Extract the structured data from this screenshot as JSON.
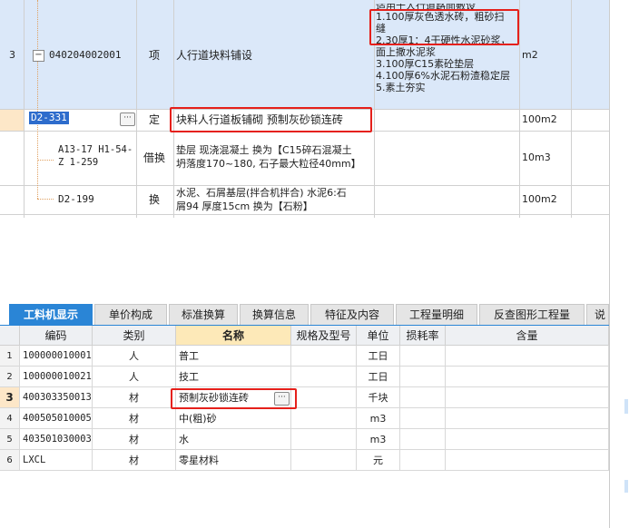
{
  "upper_rows": [
    {
      "row_no": "3",
      "code": "040204002001",
      "category": "项",
      "name": "人行道块料铺设",
      "feature_lines": [
        "适用于人行道路面敷设",
        "1.100厚灰色透水砖，粗砂扫",
        "缝",
        "2.30厚1：4干硬性水泥砂浆，",
        "面上撒水泥浆",
        "3.100厚C15素砼垫层",
        "4.100厚6%水泥石粉渣稳定层",
        "5.素土夯实"
      ],
      "unit": "m2"
    },
    {
      "code": "D2-331",
      "category": "定",
      "name": "块料人行道板铺砌 预制灰砂锁连砖",
      "unit": "100m2"
    },
    {
      "code_lines": [
        "A13-17 H1-54-",
        "Z 1-259"
      ],
      "category": "借换",
      "name_lines": [
        "垫层 现浇混凝土  换为【C15碎石混凝土",
        "坍落度170~180, 石子最大粒径40mm】"
      ],
      "unit": "10m3"
    },
    {
      "code": "D2-199",
      "category": "换",
      "name_lines": [
        "水泥、石屑基层(拌合机拌合) 水泥6:石",
        "屑94 厚度15cm  换为【石粉】"
      ],
      "unit": "100m2"
    }
  ],
  "tabs": [
    "工料机显示",
    "单价构成",
    "标准换算",
    "换算信息",
    "特征及内容",
    "工程量明细",
    "反查图形工程量",
    "说"
  ],
  "active_tab": 0,
  "lower_headers": [
    "编码",
    "类别",
    "名称",
    "规格及型号",
    "单位",
    "损耗率",
    "含量"
  ],
  "lower_rows": [
    {
      "no": "1",
      "code": "100000010001",
      "type": "人",
      "name": "普工",
      "spec": "",
      "unit": "工日",
      "loss": "",
      "qty": ""
    },
    {
      "no": "2",
      "code": "100000010021",
      "type": "人",
      "name": "技工",
      "spec": "",
      "unit": "工日",
      "loss": "",
      "qty": ""
    },
    {
      "no": "3",
      "code": "400303350013",
      "type": "材",
      "name": "预制灰砂锁连砖",
      "spec": "",
      "unit": "千块",
      "loss": "",
      "qty": ""
    },
    {
      "no": "4",
      "code": "400505010005",
      "type": "材",
      "name": "中(粗)砂",
      "spec": "",
      "unit": "m3",
      "loss": "",
      "qty": ""
    },
    {
      "no": "5",
      "code": "403501030003",
      "type": "材",
      "name": "水",
      "spec": "",
      "unit": "m3",
      "loss": "",
      "qty": ""
    },
    {
      "no": "6",
      "code": "LXCL",
      "type": "材",
      "name": "零星材料",
      "spec": "",
      "unit": "元",
      "loss": "",
      "qty": ""
    }
  ],
  "colors": {
    "tab_active": "#2a85d6",
    "highlight_red": "#e5201b",
    "row_selected": "#dbe8f9"
  }
}
